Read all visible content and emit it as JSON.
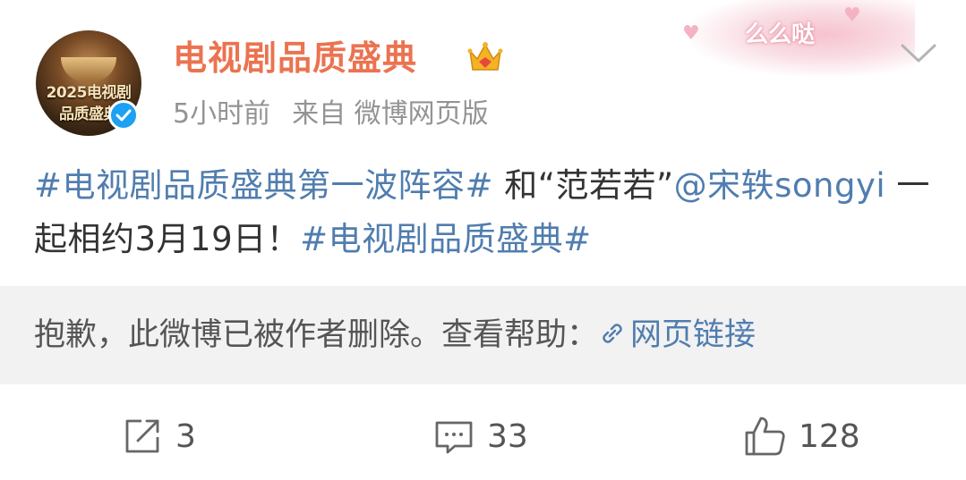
{
  "post": {
    "author": "电视剧品质盛典",
    "avatar_text_line1": "2025电视剧",
    "avatar_text_line2": "品质盛典",
    "time": "5小时前",
    "source": "来自 微博网页版",
    "decoration_text": "么么哒",
    "content": {
      "topic1": "#电视剧品质盛典第一波阵容#",
      "text1": " 和“范若若”",
      "mention": "@宋轶songyi",
      "text2": " 一起相约3月19日！",
      "topic2": "#电视剧品质盛典#"
    }
  },
  "deleted_notice": {
    "text": "抱歉，此微博已被作者删除。查看帮助：",
    "link_label": "网页链接"
  },
  "actions": {
    "repost_count": "3",
    "comment_count": "33",
    "like_count": "128"
  },
  "colors": {
    "username": "#eb7350",
    "link": "#507daf",
    "meta": "#939393",
    "deleted_bg": "#f2f2f2"
  }
}
